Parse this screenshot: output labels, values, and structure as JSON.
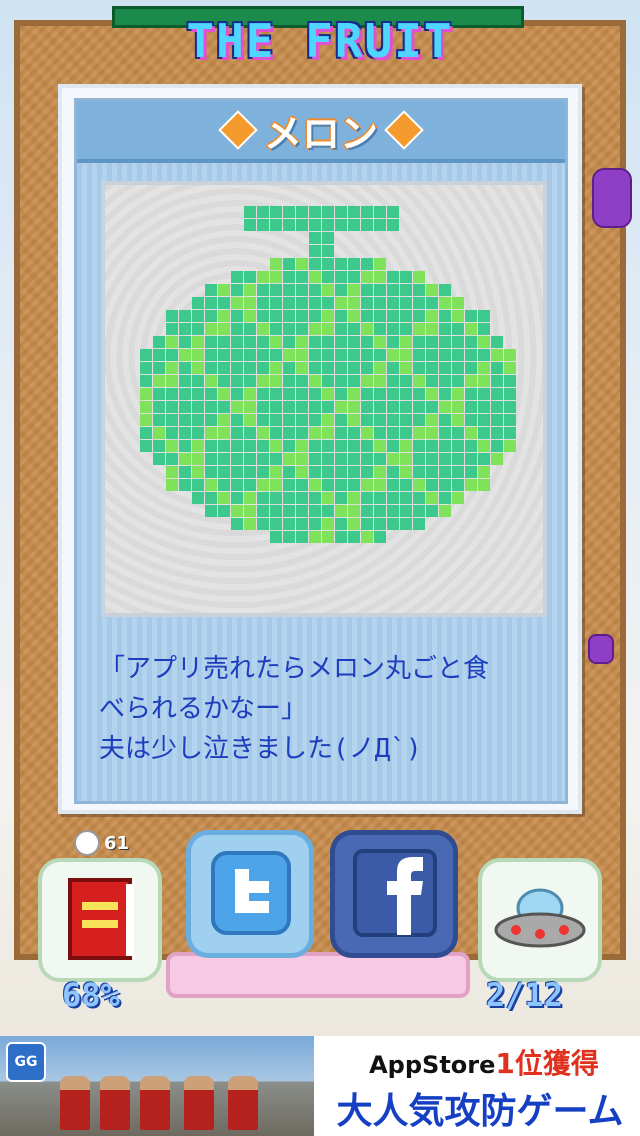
{
  "header": {
    "title": "THE FRUIT"
  },
  "card": {
    "title": "メロン",
    "description_lines": [
      "「アプリ売れたらメロン丸ごと食",
      "べられるかなー」",
      "夫は少し泣きました(ノД`)"
    ]
  },
  "coins": {
    "count": "61"
  },
  "buttons": {
    "book": {
      "icon": "book-icon"
    },
    "twitter": {
      "icon": "twitter-icon"
    },
    "facebook": {
      "icon": "facebook-icon"
    },
    "ufo": {
      "icon": "ufo-icon"
    }
  },
  "stats": {
    "collection_percent": "68%",
    "progress": "2/12"
  },
  "ad": {
    "line1_prefix": "AppStore",
    "line1_highlight": "1位獲得",
    "line2": "大人気攻防ゲーム"
  },
  "colors": {
    "melon_dark": "#3ec98c",
    "melon_light": "#7ee35a",
    "title_text": "#4fd6ff",
    "description_text": "#1c3dbd"
  }
}
